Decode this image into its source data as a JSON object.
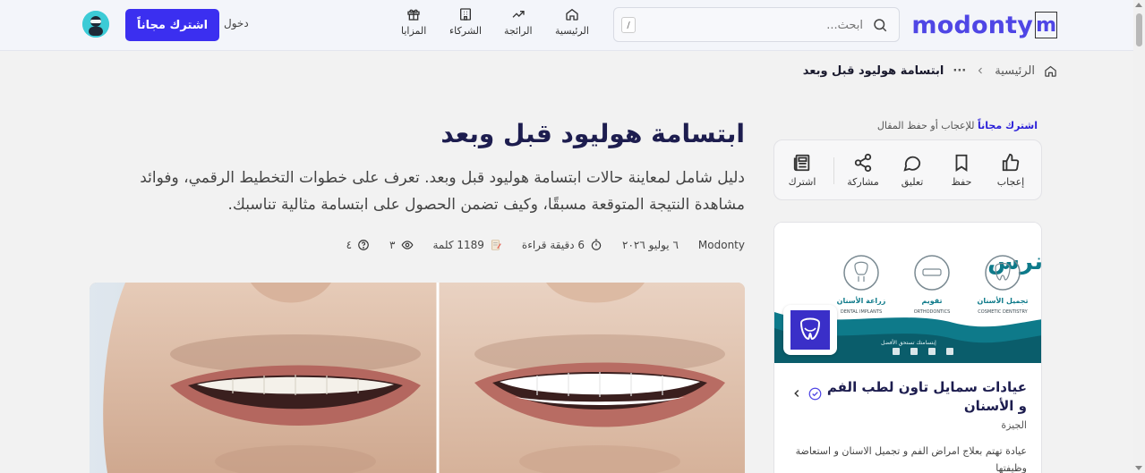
{
  "header": {
    "logo_text": "modonty",
    "search": {
      "placeholder": "ابحث...",
      "shortcut": "/"
    },
    "nav": [
      {
        "label": "الرئيسية",
        "icon": "home-icon"
      },
      {
        "label": "الرائجة",
        "icon": "trending-icon"
      },
      {
        "label": "الشركاء",
        "icon": "building-icon"
      },
      {
        "label": "المزايا",
        "icon": "gift-icon"
      }
    ],
    "login_label": "دخول",
    "subscribe_label": "اشترك مجاناً"
  },
  "breadcrumb": {
    "home": "الرئيسية",
    "ellipsis": "···",
    "current": "ابتسامة هوليود قبل وبعد"
  },
  "article": {
    "title": "ابتسامة هوليود قبل وبعد",
    "subtitle": "دليل شامل لمعاينة حالات ابتسامة هوليود قبل وبعد. تعرف على خطوات التخطيط الرقمي، وفوائد مشاهدة النتيجة المتوقعة مسبقًا، وكيف تضمن الحصول على ابتسامة مثالية تناسبك.",
    "meta": {
      "author": "Modonty",
      "date": "٦ يوليو ٢٠٢٦",
      "read_time": "6 دقيقة قراءة",
      "words": "1189 كلمة",
      "views": "٣",
      "questions": "٤"
    }
  },
  "sidebar": {
    "hint_link": "اشترك مجاناً",
    "hint_rest": " للإعجاب أو حفظ المقال",
    "actions": [
      {
        "label": "إعجاب",
        "icon": "thumbs-up-icon"
      },
      {
        "label": "حفظ",
        "icon": "bookmark-icon"
      },
      {
        "label": "تعليق",
        "icon": "comment-icon"
      },
      {
        "label": "مشاركة",
        "icon": "share-icon"
      },
      {
        "label": "اشترك",
        "icon": "newspaper-icon"
      }
    ],
    "card": {
      "banner_services": [
        "تجميل الأسنان",
        "تقويم",
        "زراعة الأسنان"
      ],
      "banner_services_en": [
        "COSMETIC DENTISTRY",
        "ORTHODONTICS",
        "DENTAL IMPLANTS"
      ],
      "banner_tagline": "إبتسامتك تستحق الأفضل",
      "banner_partial": "نرس",
      "name": "عيادات سمايل تاون لطب الفم و الأسنان",
      "location": "الجيزة",
      "description": "عيادة تهتم بعلاج امراض الفم و تجميل الاسنان و استعاضة وظيفتها"
    }
  },
  "colors": {
    "brand": "#4f46e5",
    "button": "#3b2ff0",
    "title": "#1d1d4f"
  }
}
